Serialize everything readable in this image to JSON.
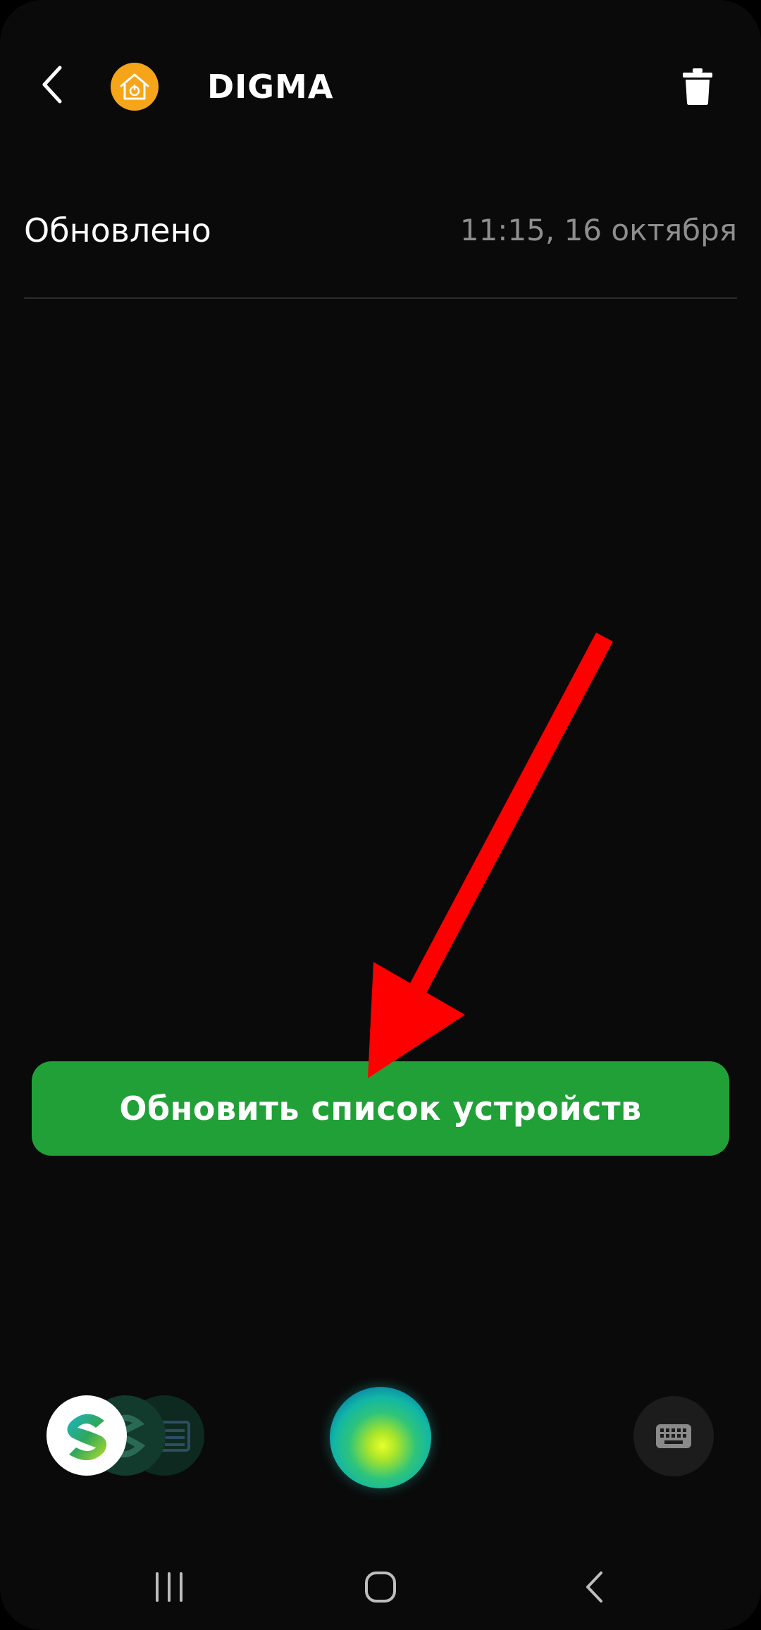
{
  "header": {
    "title": "DIGMA",
    "back_icon": "chevron-left-icon",
    "app_icon": "home-power-icon",
    "trash_icon": "trash-icon"
  },
  "info": {
    "label": "Обновлено",
    "value": "11:15, 16 октября"
  },
  "main": {
    "refresh_button_label": "Обновить список устройств"
  },
  "assistant_bar": {
    "avatars": [
      "sber-logo-icon",
      "sber-logo-icon",
      "card-icon"
    ],
    "assistant_icon": "assistant-orb-icon",
    "keyboard_icon": "keyboard-icon"
  },
  "system_nav": {
    "recent_icon": "recent-apps-icon",
    "home_icon": "home-icon",
    "back_icon": "back-icon"
  },
  "colors": {
    "background": "#0a0a0a",
    "accent_green": "#21a038",
    "app_icon_orange": "#f6a519",
    "secondary_text": "#8e8e8e",
    "annotation_red": "#ff0000"
  }
}
